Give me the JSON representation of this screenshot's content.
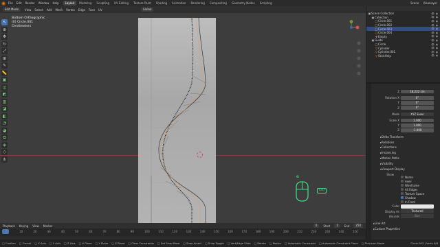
{
  "topbar": {
    "menus": [
      "File",
      "Edit",
      "Render",
      "Window",
      "Help"
    ],
    "tabs": [
      "Layout",
      "Modeling",
      "Sculpting",
      "UV Editing",
      "Texture Paint",
      "Shading",
      "Animation",
      "Rendering",
      "Compositing",
      "Geometry Nodes",
      "Scripting"
    ],
    "active_tab": "Layout",
    "scene": "Scene",
    "view_layer": "ViewLayer"
  },
  "viewport_header": {
    "mode": "Edit Mode",
    "menus": [
      "View",
      "Select",
      "Add",
      "Mesh",
      "Vertex",
      "Edge",
      "Face",
      "UV"
    ],
    "transform": "Global"
  },
  "viewport_info": {
    "view": "Bottom Orthographic",
    "object": "(0) Circle.001",
    "units": "Centimeters"
  },
  "overlay_hint": {
    "key": "G",
    "modifier": "Ctrl"
  },
  "outliner": {
    "rows": [
      {
        "label": "Scene Collection",
        "indent": 0,
        "icon": "▣"
      },
      {
        "label": "Collection",
        "indent": 1,
        "icon": "▣"
      },
      {
        "label": "Circle.001",
        "indent": 2,
        "icon": "◯"
      },
      {
        "label": "Circle.002",
        "indent": 2,
        "icon": "◯"
      },
      {
        "label": "Circle.003",
        "indent": 2,
        "icon": "◯",
        "selected": true
      },
      {
        "label": "Circle.004",
        "indent": 2,
        "icon": "◯"
      },
      {
        "label": "Empty",
        "indent": 2,
        "icon": "✣"
      },
      {
        "label": "Guide",
        "indent": 1,
        "icon": "▣"
      },
      {
        "label": "Circle",
        "indent": 2,
        "icon": "◯"
      },
      {
        "label": "Cylinder",
        "indent": 2,
        "icon": "▽"
      },
      {
        "label": "Cylinder.001",
        "indent": 2,
        "icon": "▽"
      },
      {
        "label": "StickHelp",
        "indent": 2,
        "icon": "▽"
      }
    ]
  },
  "properties": {
    "location_z": "18.222 cm",
    "rotation_label": "Rotation X",
    "rotation": [
      "0°",
      "0°",
      "0°"
    ],
    "mode_label": "Mode",
    "mode_value": "XYZ Euler",
    "scale_label": "Scale X",
    "scale": [
      "1.000",
      "1.000",
      "-1.000"
    ],
    "sections": [
      "Delta Transform",
      "Relations",
      "Collections",
      "Instancing",
      "Motion Paths",
      "Visibility",
      "Viewport Display"
    ],
    "show_label": "Show",
    "show_options": [
      {
        "label": "Name",
        "checked": false
      },
      {
        "label": "Axes",
        "checked": false
      },
      {
        "label": "Wireframe",
        "checked": false
      },
      {
        "label": "All Edges",
        "checked": false
      },
      {
        "label": "Texture Space",
        "checked": false
      },
      {
        "label": "Shadow",
        "checked": true
      },
      {
        "label": "In Front",
        "checked": false
      }
    ],
    "color_label": "Color",
    "display_as_label": "Display As",
    "display_as_value": "Textured",
    "bounds_label": "Bounds",
    "bounds_value": "Box",
    "footer_sections": [
      "Line Art",
      "Custom Properties"
    ]
  },
  "timeline": {
    "menus": [
      "Playback",
      "Keying",
      "View",
      "Marker"
    ],
    "current_frame": "0",
    "start_label": "Start",
    "start": "1",
    "end_label": "End",
    "end": "250",
    "ticks": [
      "0",
      "10",
      "20",
      "30",
      "40",
      "50",
      "60",
      "70",
      "80",
      "90",
      "100",
      "110",
      "120",
      "130",
      "140",
      "150",
      "160",
      "170",
      "180",
      "190",
      "200",
      "210",
      "220",
      "230",
      "240",
      "250"
    ]
  },
  "status": {
    "items": [
      "Confirm",
      "Cancel",
      "X Axis",
      "Y Axis",
      "Z Axis",
      "X Plane",
      "Y Plane",
      "Z Plane",
      "Clear Constraints",
      "Set Snap Base",
      "Snap Invert",
      "Snap Toggle",
      "Vert/Edge Slide",
      "Rotate",
      "Resize",
      "Automatic Constraint",
      "Automatic Constraint Plane",
      "Precision Mode"
    ],
    "object_info": "Circle.003 | Verts 0/6"
  }
}
